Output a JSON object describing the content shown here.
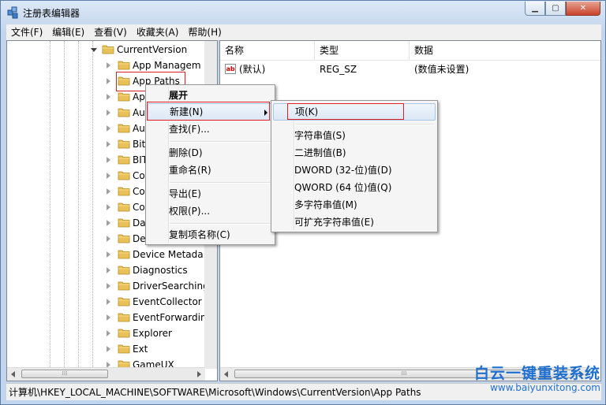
{
  "window": {
    "title": "注册表编辑器"
  },
  "menubar": [
    "文件(F)",
    "编辑(E)",
    "查看(V)",
    "收藏夹(A)",
    "帮助(H)"
  ],
  "tree": {
    "parent": "CurrentVersion",
    "children": [
      "App Managem",
      "App Paths",
      "Ap",
      "Au",
      "Au",
      "Bit",
      "BIT",
      "Co",
      "Co",
      "Co",
      "Da",
      "De",
      "Device Metada",
      "Diagnostics",
      "DriverSearching",
      "EventCollector",
      "EventForwardin",
      "Explorer",
      "Ext",
      "GameUX"
    ],
    "selected": "App Paths"
  },
  "list": {
    "columns": [
      "名称",
      "类型",
      "数据"
    ],
    "rows": [
      {
        "icon": "ab",
        "name": "(默认)",
        "type": "REG_SZ",
        "data": "(数值未设置)"
      }
    ]
  },
  "context_menu": {
    "items": [
      "展开",
      "新建(N)",
      "查找(F)...",
      "删除(D)",
      "重命名(R)",
      "导出(E)",
      "权限(P)...",
      "复制项名称(C)"
    ]
  },
  "submenu": {
    "items": [
      "项(K)",
      "字符串值(S)",
      "二进制值(B)",
      "DWORD (32-位)值(D)",
      "QWORD (64 位)值(Q)",
      "多字符串值(M)",
      "可扩充字符串值(E)"
    ]
  },
  "status": "计算机\\HKEY_LOCAL_MACHINE\\SOFTWARE\\Microsoft\\Windows\\CurrentVersion\\App Paths",
  "watermark": {
    "title": "白云一键重装系统",
    "url": "www.baiyunxitong.com"
  },
  "colors": {
    "folder": "#e8c15a",
    "highlight_box": "#e02020",
    "watermark": "#1e6fd0"
  }
}
